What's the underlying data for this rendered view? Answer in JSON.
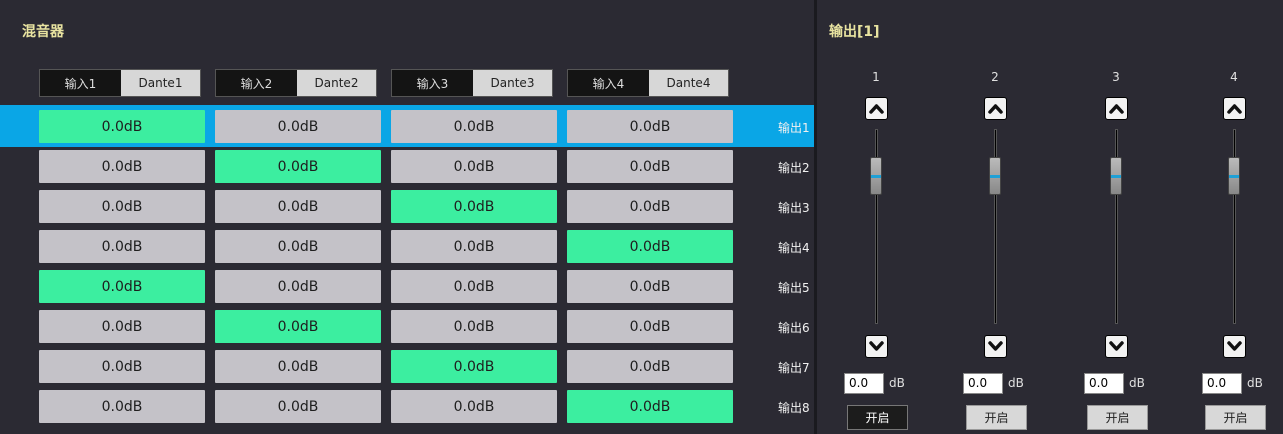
{
  "mixer": {
    "title": "混音器",
    "inputs": [
      {
        "name": "输入1",
        "source": "Dante1"
      },
      {
        "name": "输入2",
        "source": "Dante2"
      },
      {
        "name": "输入3",
        "source": "Dante3"
      },
      {
        "name": "输入4",
        "source": "Dante4"
      }
    ],
    "rows": [
      {
        "label": "输出1",
        "cells": [
          "0.0dB",
          "0.0dB",
          "0.0dB",
          "0.0dB"
        ],
        "active": 0,
        "selected": true
      },
      {
        "label": "输出2",
        "cells": [
          "0.0dB",
          "0.0dB",
          "0.0dB",
          "0.0dB"
        ],
        "active": 1,
        "selected": false
      },
      {
        "label": "输出3",
        "cells": [
          "0.0dB",
          "0.0dB",
          "0.0dB",
          "0.0dB"
        ],
        "active": 2,
        "selected": false
      },
      {
        "label": "输出4",
        "cells": [
          "0.0dB",
          "0.0dB",
          "0.0dB",
          "0.0dB"
        ],
        "active": 3,
        "selected": false
      },
      {
        "label": "输出5",
        "cells": [
          "0.0dB",
          "0.0dB",
          "0.0dB",
          "0.0dB"
        ],
        "active": 0,
        "selected": false
      },
      {
        "label": "输出6",
        "cells": [
          "0.0dB",
          "0.0dB",
          "0.0dB",
          "0.0dB"
        ],
        "active": 1,
        "selected": false
      },
      {
        "label": "输出7",
        "cells": [
          "0.0dB",
          "0.0dB",
          "0.0dB",
          "0.0dB"
        ],
        "active": 2,
        "selected": false
      },
      {
        "label": "输出8",
        "cells": [
          "0.0dB",
          "0.0dB",
          "0.0dB",
          "0.0dB"
        ],
        "active": 3,
        "selected": false
      }
    ]
  },
  "output": {
    "title": "输出[1]",
    "channels": [
      {
        "num": "1",
        "value": "0.0",
        "unit": "dB",
        "button": "开启",
        "button_style": "dark",
        "level": 0.82
      },
      {
        "num": "2",
        "value": "0.0",
        "unit": "dB",
        "button": "开启",
        "button_style": "light",
        "level": 0.82
      },
      {
        "num": "3",
        "value": "0.0",
        "unit": "dB",
        "button": "开启",
        "button_style": "light",
        "level": 0.82
      },
      {
        "num": "4",
        "value": "0.0",
        "unit": "dB",
        "button": "开启",
        "button_style": "light",
        "level": 0.82
      }
    ]
  },
  "colors": {
    "active_cell": "#3ceea0",
    "selected_row": "#0aa6e6",
    "title": "#e8e3a0"
  },
  "icons": {
    "up": "chevron-up-icon",
    "down": "chevron-down-icon"
  }
}
